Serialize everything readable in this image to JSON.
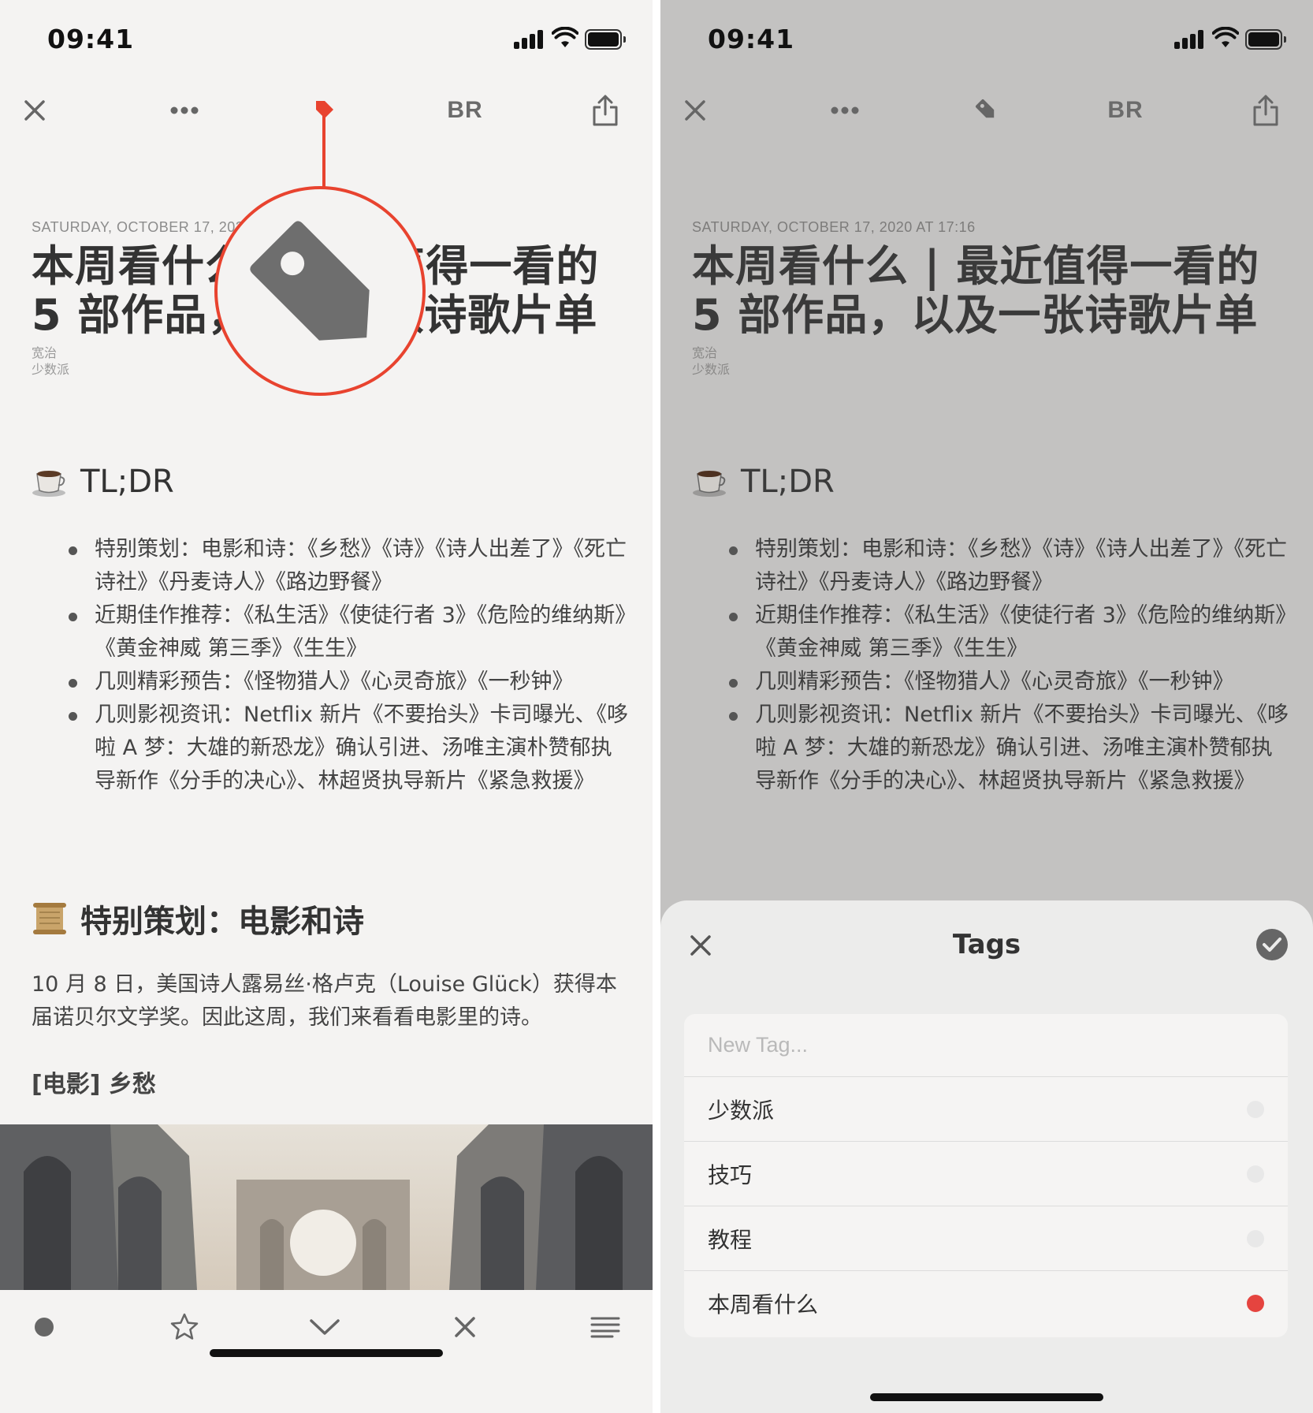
{
  "status_bar": {
    "time": "09:41"
  },
  "toolbar": {
    "br_label": "BR"
  },
  "article": {
    "date": "SATURDAY, OCTOBER 17, 2020 AT 17:16",
    "title_line1": "本周看什么 | 最近值得一看的",
    "title_line2": "5 部作品，以及一张诗歌片单",
    "author": "宽治",
    "source": "少数派",
    "tldr_heading": "TL;DR",
    "tldr_items": [
      "特别策划：电影和诗：《乡愁》《诗》《诗人出差了》《死亡诗社》《丹麦诗人》《路边野餐》",
      "近期佳作推荐：《私生活》《使徒行者 3》《危险的维纳斯》《黄金神威 第三季》《生生》",
      "几则精彩预告：《怪物猎人》《心灵奇旅》《一秒钟》",
      "几则影视资讯：Netflix 新片《不要抬头》卡司曝光、《哆啦 A 梦：大雄的新恐龙》确认引进、汤唯主演朴赞郁执导新作《分手的决心》、林超贤执导新片《紧急救援》"
    ],
    "section_heading": "特别策划：电影和诗",
    "paragraph": "10 月 8 日，美国诗人露易丝·格卢克（Louise Glück）获得本届诺贝尔文学奖。因此这周，我们来看看电影里的诗。",
    "subheading": "[电影] 乡愁"
  },
  "tags_sheet": {
    "title": "Tags",
    "new_tag_placeholder": "New Tag...",
    "tags": [
      {
        "name": "少数派",
        "selected": false
      },
      {
        "name": "技巧",
        "selected": false
      },
      {
        "name": "教程",
        "selected": false
      },
      {
        "name": "本周看什么",
        "selected": true
      }
    ]
  },
  "colors": {
    "accent": "#e8432f",
    "tag_selected": "#e5443f",
    "left_bg": "#f4f3f2",
    "right_dim_bg": "#c3c2c1"
  },
  "icons": [
    "close-icon",
    "more-icon",
    "tag-icon",
    "share-icon",
    "unread-dot-icon",
    "star-icon",
    "chevron-down-icon",
    "list-icon",
    "checkmark-icon"
  ]
}
